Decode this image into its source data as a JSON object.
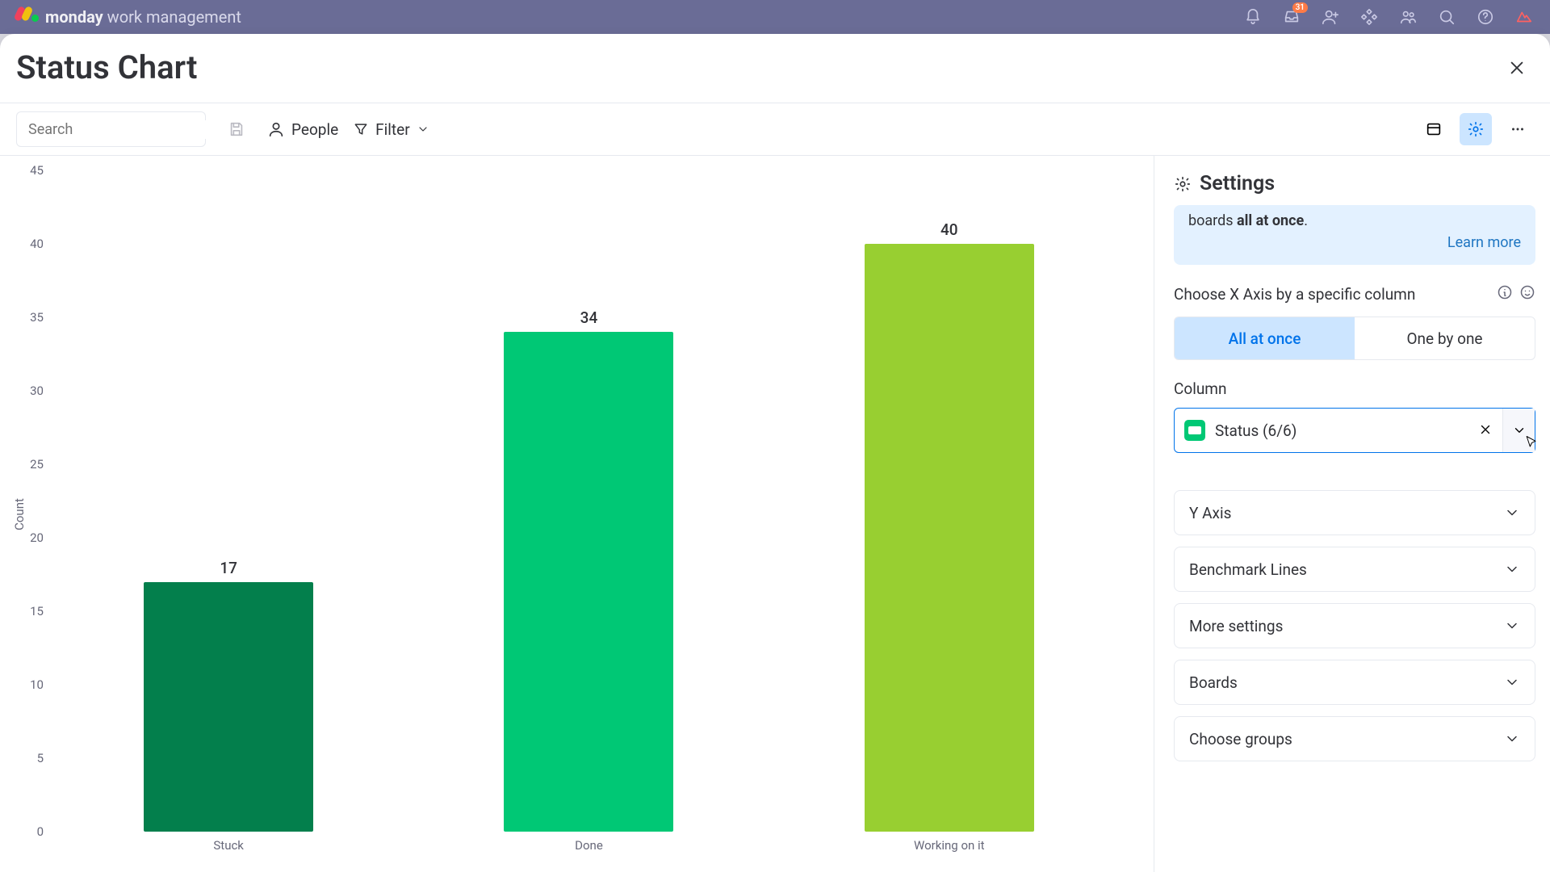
{
  "topbar": {
    "brand_bold": "monday",
    "brand_rest": " work management",
    "inbox_badge": "31"
  },
  "title": "Status Chart",
  "toolbar": {
    "search_placeholder": "Search",
    "people": "People",
    "filter": "Filter"
  },
  "chart_data": {
    "type": "bar",
    "categories": [
      "Stuck",
      "Done",
      "Working on it"
    ],
    "values": [
      17,
      34,
      40
    ],
    "colors": [
      "#037f4c",
      "#00c875",
      "#98cf31"
    ],
    "title": "",
    "xlabel": "",
    "ylabel": "Count",
    "ylim": [
      0,
      45
    ],
    "yticks": [
      0,
      5,
      10,
      15,
      20,
      25,
      30,
      35,
      40,
      45
    ],
    "gridlines": false
  },
  "settings": {
    "heading": "Settings",
    "info_prefix": "boards ",
    "info_bold": "all at once",
    "info_suffix": ".",
    "learn_more": "Learn more",
    "xaxis_label": "Choose X Axis by a specific column",
    "segments": {
      "all": "All at once",
      "one": "One by one"
    },
    "column_label": "Column",
    "column_value": "Status (6/6)",
    "accordions": [
      "Y Axis",
      "Benchmark Lines",
      "More settings",
      "Boards",
      "Choose groups"
    ]
  }
}
